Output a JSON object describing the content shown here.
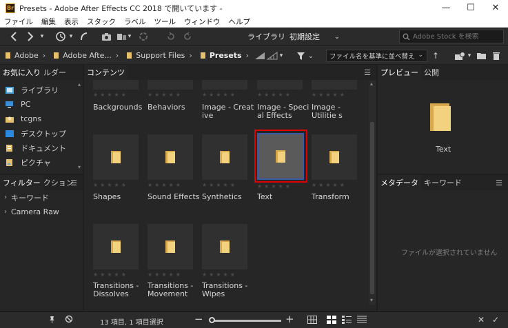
{
  "window": {
    "title": "Presets - Adobe After Effects CC 2018 で開いています -",
    "app_badge": "Br",
    "minimize": "—",
    "maximize": "☐",
    "close": "✕"
  },
  "menu": [
    "ファイル",
    "編集",
    "表示",
    "スタック",
    "ラベル",
    "ツール",
    "ウィンドウ",
    "ヘルプ"
  ],
  "toolbar": {
    "workspaces": [
      "ライブラリ",
      "初期設定"
    ],
    "search_placeholder": "Adobe Stock を検索"
  },
  "path": {
    "crumbs": [
      "Adobe",
      "Adobe Afte...",
      "Support Files",
      "Presets"
    ],
    "sort_label": "ファイル名を基準に並べ替え"
  },
  "favorites": {
    "tabs": [
      "お気に入り",
      "ルダー"
    ],
    "items": [
      {
        "label": "ライブラリ",
        "icon": "library-icon"
      },
      {
        "label": "PC",
        "icon": "pc-icon"
      },
      {
        "label": "tcgns",
        "icon": "user-icon"
      },
      {
        "label": "デスクトップ",
        "icon": "desktop-icon"
      },
      {
        "label": "ドキュメント",
        "icon": "document-icon"
      },
      {
        "label": "ピクチャ",
        "icon": "picture-icon"
      }
    ]
  },
  "filter": {
    "tabs": [
      "フィルター",
      "クション"
    ],
    "items": [
      "キーワード",
      "Camera Raw"
    ]
  },
  "content": {
    "tab": "コンテンツ",
    "items": [
      "Backgrounds",
      "Behaviors",
      "Image - Creat ive",
      "Image - Speci al Effects",
      "Image - Utilitie s",
      "Shapes",
      "Sound Effects",
      "Synthetics",
      "Text",
      "Transform",
      "Transitions - Dissolves",
      "Transitions - Movement",
      "Transitions - Wipes"
    ],
    "selected": "Text"
  },
  "preview": {
    "tabs": [
      "プレビュー",
      "公開"
    ],
    "name": "Text"
  },
  "metadata": {
    "tabs": [
      "メタデータ",
      "キーワード"
    ],
    "empty_message": "ファイルが選択されていません"
  },
  "status": {
    "summary": "13 項目, 1 項目選択"
  },
  "colors": {
    "selection_outline": "#e00000",
    "folder": "#f2d27e"
  }
}
